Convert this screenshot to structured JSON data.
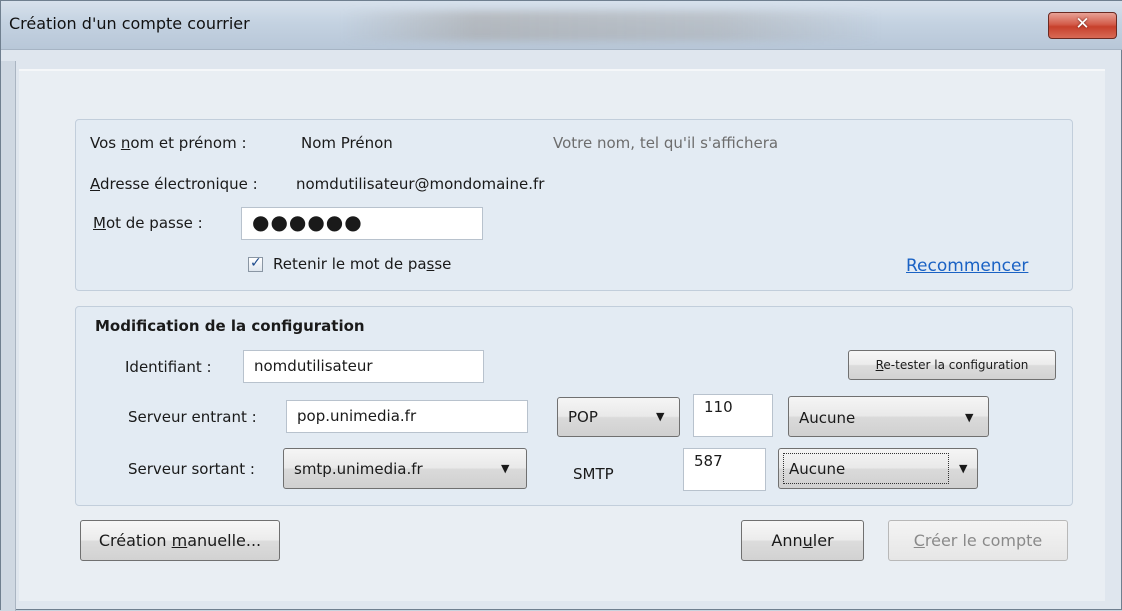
{
  "window": {
    "title": "Création d'un compte courrier",
    "close_icon": "close-icon"
  },
  "identity": {
    "name_label_pre": "Vos ",
    "name_label_u": "n",
    "name_label_post": "om et prénom :",
    "name_value": "Nom Prénon",
    "name_hint": "Votre nom, tel qu'il s'affichera",
    "email_label_u": "A",
    "email_label_post": "dresse électronique :",
    "email_value": "nomdutilisateur@mondomaine.fr",
    "password_label_u": "M",
    "password_label_post": "ot de passe :",
    "password_value": "●●●●●●",
    "remember_pre": "Retenir le mot de pa",
    "remember_u": "s",
    "remember_post": "se",
    "remember_checked": true,
    "restart_link": "Recommencer"
  },
  "config": {
    "heading": "Modification de la configuration",
    "identifier_label": "Identifiant :",
    "identifier_value": "nomdutilisateur",
    "retest_u": "R",
    "retest_post": "e-tester la configuration",
    "incoming_label": "Serveur entrant :",
    "incoming_host": "pop.unimedia.fr",
    "incoming_protocol": "POP",
    "incoming_port": "110",
    "incoming_security": "Aucune",
    "outgoing_label": "Serveur sortant :",
    "outgoing_host": "smtp.unimedia.fr",
    "outgoing_protocol": "SMTP",
    "outgoing_port": "587",
    "outgoing_security": "Aucune"
  },
  "footer": {
    "manual_pre": "Création ",
    "manual_u": "m",
    "manual_post": "anuelle...",
    "cancel_pre": "Ann",
    "cancel_u": "u",
    "cancel_post": "ler",
    "create_u": "C",
    "create_post": "réer le compte"
  }
}
